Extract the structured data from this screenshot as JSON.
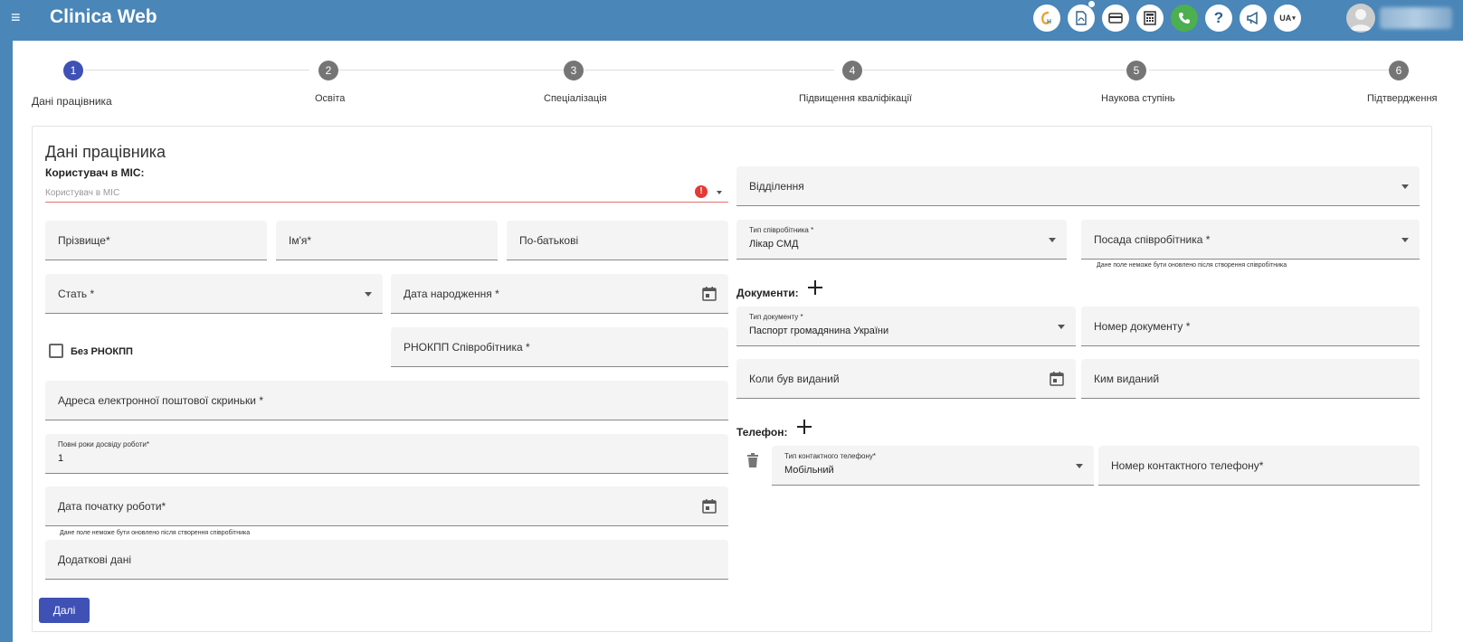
{
  "app": {
    "title": "Clinica Web",
    "lang": "UA"
  },
  "toolbar": {
    "icons": [
      "logo-icon",
      "pdf-icon",
      "card-icon",
      "calculator-icon",
      "phone-icon",
      "help-icon",
      "megaphone-icon",
      "language-icon"
    ],
    "help_label": "?"
  },
  "stepper": {
    "steps": [
      {
        "number": "1",
        "label": "Дані працівника"
      },
      {
        "number": "2",
        "label": "Освіта"
      },
      {
        "number": "3",
        "label": "Спеціалізація"
      },
      {
        "number": "4",
        "label": "Підвищення кваліфікації"
      },
      {
        "number": "5",
        "label": "Наукова ступінь"
      },
      {
        "number": "6",
        "label": "Підтвердження"
      }
    ]
  },
  "form": {
    "section_title": "Дані працівника",
    "mis_label": "Користувач в МІС:",
    "mis_placeholder": "Користувач в МІС",
    "error_mark": "!",
    "surname": "Прізвище*",
    "name": "Ім'я*",
    "patronymic": "По-батькові",
    "gender": "Стать *",
    "birth_date": "Дата народження *",
    "no_rnokpp": "Без РНОКПП",
    "rnokpp": "РНОКПП Співробітника *",
    "email": "Адреса електронної поштової скриньки *",
    "experience_label": "Повні роки досвіду роботи*",
    "experience_value": "1",
    "work_start": "Дата початку роботи*",
    "work_start_hint": "Дане поле неможе бути оновлено після створення співробітника",
    "additional": "Додаткові дані",
    "department": "Відділення",
    "employee_type_label": "Тип співробітника *",
    "employee_type_value": "Лікар СМД",
    "position": "Посада співробітника *",
    "position_hint": "Дане поле неможе бути оновлено після створення співробітника",
    "documents_label": "Документи:",
    "doc_type_label": "Тип документу *",
    "doc_type_value": "Паспорт громадянина України",
    "doc_number": "Номер документу *",
    "issued_date": "Коли був виданий",
    "issued_by": "Ким виданий",
    "phone_label": "Телефон:",
    "phone_type_label": "Тип контактного телефону*",
    "phone_type_value": "Мобільний",
    "phone_number": "Номер контактного телефону*",
    "next_button": "Далі"
  }
}
